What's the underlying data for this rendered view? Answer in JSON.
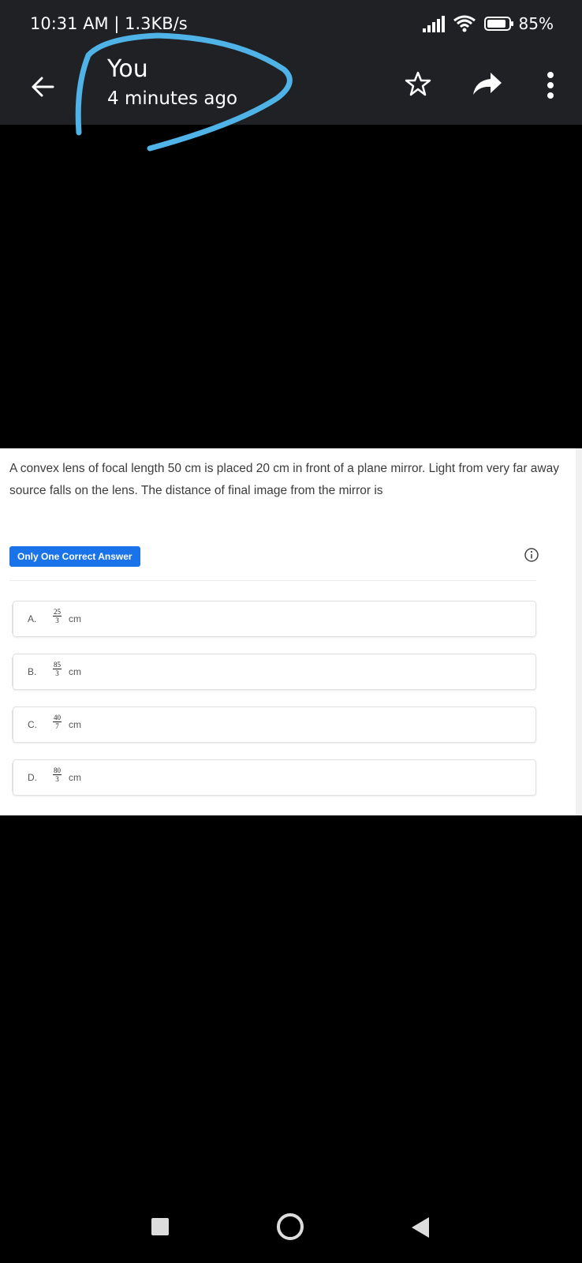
{
  "status_bar": {
    "time": "10:31 AM",
    "separator": "|",
    "network_speed": "1.3KB/s",
    "battery": "85%",
    "icons": [
      "signal-icon",
      "wifi-icon",
      "battery-icon"
    ]
  },
  "header": {
    "sender": "You",
    "sent_time": "4 minutes ago",
    "icons": [
      "back-arrow-icon",
      "star-icon",
      "share-icon",
      "more-vert-icon"
    ]
  },
  "question": {
    "text": "A convex lens of focal length 50 cm is placed 20 cm in front of a plane mirror. Light from very far away source falls on the lens. The distance of final image from the mirror is",
    "badge": "Only One Correct Answer",
    "options": [
      {
        "letter": "A.",
        "numerator": "25",
        "denominator": "3",
        "unit": "cm"
      },
      {
        "letter": "B.",
        "numerator": "85",
        "denominator": "3",
        "unit": "cm"
      },
      {
        "letter": "C.",
        "numerator": "40",
        "denominator": "7",
        "unit": "cm"
      },
      {
        "letter": "D.",
        "numerator": "80",
        "denominator": "3",
        "unit": "cm"
      }
    ]
  },
  "colors": {
    "top_bar": "#1f2125",
    "badge": "#1a73e8",
    "annotation_stroke": "#4fb3e8"
  }
}
